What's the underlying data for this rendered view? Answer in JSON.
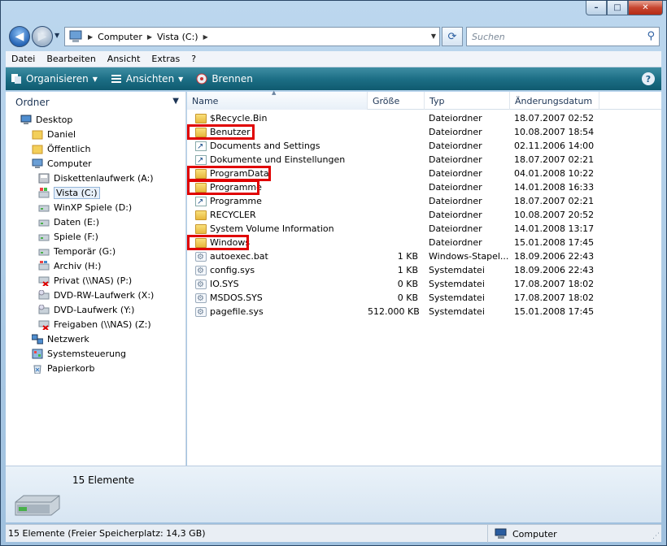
{
  "window": {
    "caption_min": "–",
    "caption_max": "□",
    "caption_close": "✕"
  },
  "address": {
    "crumbs": [
      "Computer",
      "Vista (C:)"
    ],
    "search_placeholder": "Suchen"
  },
  "menu": [
    "Datei",
    "Bearbeiten",
    "Ansicht",
    "Extras",
    "?"
  ],
  "commands": {
    "organize": "Organisieren",
    "views": "Ansichten",
    "burn": "Brennen",
    "help": "?"
  },
  "navpane": {
    "header": "Ordner",
    "items": [
      {
        "label": "Desktop",
        "level": 0,
        "icon": "desktop-icon"
      },
      {
        "label": "Daniel",
        "level": 1,
        "icon": "folder-icon"
      },
      {
        "label": "Öffentlich",
        "level": 1,
        "icon": "folder-icon"
      },
      {
        "label": "Computer",
        "level": 1,
        "icon": "computer-icon"
      },
      {
        "label": "Diskettenlaufwerk (A:)",
        "level": 2,
        "icon": "floppy-icon"
      },
      {
        "label": "Vista (C:)",
        "level": 2,
        "icon": "windows-drive-icon",
        "selected": true
      },
      {
        "label": "WinXP Spiele (D:)",
        "level": 2,
        "icon": "drive-icon"
      },
      {
        "label": "Daten (E:)",
        "level": 2,
        "icon": "drive-icon"
      },
      {
        "label": "Spiele (F:)",
        "level": 2,
        "icon": "drive-icon"
      },
      {
        "label": "Temporär (G:)",
        "level": 2,
        "icon": "drive-icon"
      },
      {
        "label": "Archiv (H:)",
        "level": 2,
        "icon": "xp-drive-icon"
      },
      {
        "label": "Privat (\\\\NAS) (P:)",
        "level": 2,
        "icon": "network-drive-disconnected-icon"
      },
      {
        "label": "DVD-RW-Laufwerk (X:)",
        "level": 2,
        "icon": "dvd-drive-icon"
      },
      {
        "label": "DVD-Laufwerk (Y:)",
        "level": 2,
        "icon": "dvd-drive-icon"
      },
      {
        "label": "Freigaben (\\\\NAS) (Z:)",
        "level": 2,
        "icon": "network-drive-disconnected-icon"
      },
      {
        "label": "Netzwerk",
        "level": 1,
        "icon": "network-icon"
      },
      {
        "label": "Systemsteuerung",
        "level": 1,
        "icon": "control-panel-icon"
      },
      {
        "label": "Papierkorb",
        "level": 1,
        "icon": "recycle-bin-icon"
      }
    ]
  },
  "columns": {
    "name": "Name",
    "size": "Größe",
    "type": "Typ",
    "date": "Änderungsdatum"
  },
  "files": [
    {
      "name": "$Recycle.Bin",
      "size": "",
      "type": "Dateiordner",
      "date": "18.07.2007 02:52",
      "icon": "folder"
    },
    {
      "name": "Benutzer",
      "size": "",
      "type": "Dateiordner",
      "date": "10.08.2007 18:54",
      "icon": "folder",
      "highlight": true
    },
    {
      "name": "Documents and Settings",
      "size": "",
      "type": "Dateiordner",
      "date": "02.11.2006 14:00",
      "icon": "shortcut"
    },
    {
      "name": "Dokumente und Einstellungen",
      "size": "",
      "type": "Dateiordner",
      "date": "18.07.2007 02:21",
      "icon": "shortcut"
    },
    {
      "name": "ProgramData",
      "size": "",
      "type": "Dateiordner",
      "date": "04.01.2008 10:22",
      "icon": "folder",
      "highlight": true
    },
    {
      "name": "Programme",
      "size": "",
      "type": "Dateiordner",
      "date": "14.01.2008 16:33",
      "icon": "folder",
      "highlight": true
    },
    {
      "name": "Programme",
      "size": "",
      "type": "Dateiordner",
      "date": "18.07.2007 02:21",
      "icon": "shortcut"
    },
    {
      "name": "RECYCLER",
      "size": "",
      "type": "Dateiordner",
      "date": "10.08.2007 20:52",
      "icon": "folder"
    },
    {
      "name": "System Volume Information",
      "size": "",
      "type": "Dateiordner",
      "date": "14.01.2008 13:17",
      "icon": "folder"
    },
    {
      "name": "Windows",
      "size": "",
      "type": "Dateiordner",
      "date": "15.01.2008 17:45",
      "icon": "folder",
      "highlight": true
    },
    {
      "name": "autoexec.bat",
      "size": "1 KB",
      "type": "Windows-Stapel...",
      "date": "18.09.2006 22:43",
      "icon": "sysfile"
    },
    {
      "name": "config.sys",
      "size": "1 KB",
      "type": "Systemdatei",
      "date": "18.09.2006 22:43",
      "icon": "sysfile"
    },
    {
      "name": "IO.SYS",
      "size": "0 KB",
      "type": "Systemdatei",
      "date": "17.08.2007 18:02",
      "icon": "sysfile"
    },
    {
      "name": "MSDOS.SYS",
      "size": "0 KB",
      "type": "Systemdatei",
      "date": "17.08.2007 18:02",
      "icon": "sysfile"
    },
    {
      "name": "pagefile.sys",
      "size": "512.000 KB",
      "type": "Systemdatei",
      "date": "15.01.2008 17:45",
      "icon": "sysfile"
    }
  ],
  "details": {
    "count": "15 Elemente"
  },
  "status": {
    "left": "15 Elemente (Freier Speicherplatz: 14,3 GB)",
    "zone": "Computer"
  }
}
